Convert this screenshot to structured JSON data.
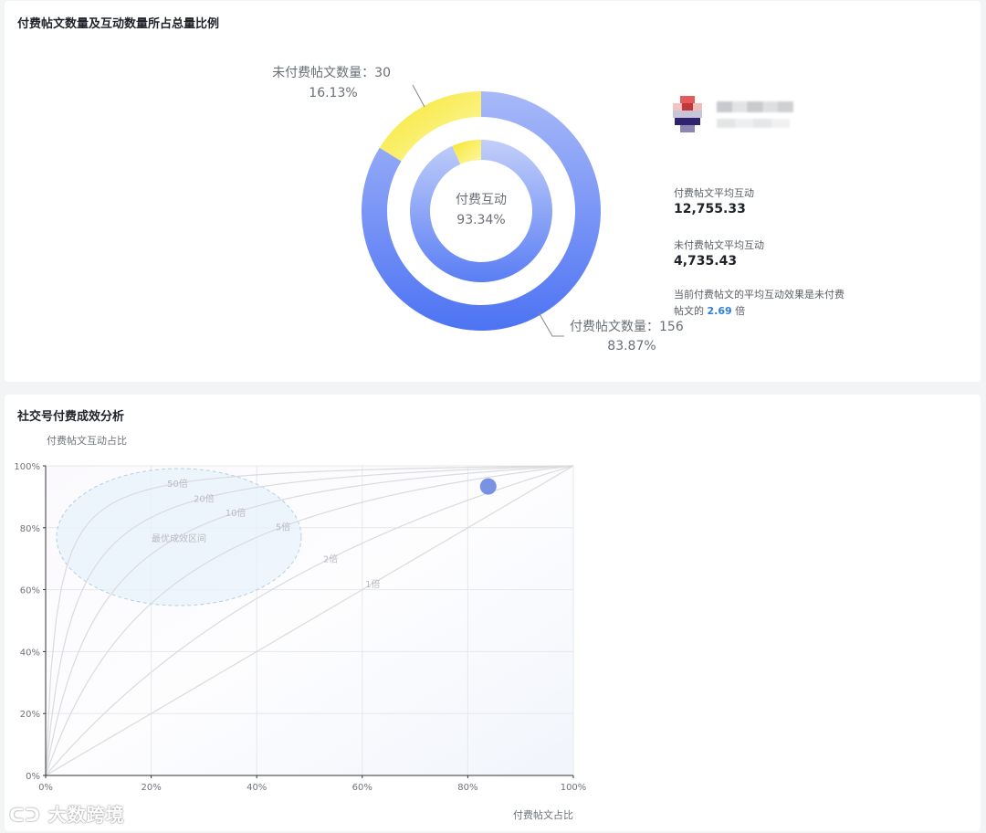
{
  "section1": {
    "title": "付费帖文数量及互动数量所占总量比例",
    "center_label": "付费互动",
    "center_value": "93.34%",
    "unpaid_label": "未付费帖文数量：30",
    "unpaid_pct": "16.13%",
    "paid_label": "付费帖文数量：156",
    "paid_pct": "83.87%",
    "colors": {
      "paid": "#5b7ff5",
      "unpaid": "#fbe84a",
      "inner_paid": "#7d9bf7"
    }
  },
  "chart_data": {
    "type": "scatter",
    "title": "社交号付费成效分析",
    "xlabel": "付费帖文占比",
    "ylabel": "付费帖文互动占比",
    "xlim": [
      0,
      100
    ],
    "ylim": [
      0,
      100
    ],
    "x_ticks": [
      "0%",
      "20%",
      "40%",
      "60%",
      "80%",
      "100%"
    ],
    "y_ticks": [
      "0%",
      "20%",
      "40%",
      "60%",
      "80%",
      "100%"
    ],
    "reference_curves": [
      {
        "label": "1倍",
        "multiple": 1
      },
      {
        "label": "2倍",
        "multiple": 2
      },
      {
        "label": "5倍",
        "multiple": 5
      },
      {
        "label": "10倍",
        "multiple": 10
      },
      {
        "label": "20倍",
        "multiple": 20
      },
      {
        "label": "50倍",
        "multiple": 50
      }
    ],
    "optimal_zone_label": "最优成效区间",
    "points": [
      {
        "x": 83.87,
        "y": 93.34
      }
    ],
    "grid": true,
    "point_color": "#6a86e0"
  },
  "stats": {
    "paid_avg_label": "付费帖文平均互动",
    "paid_avg_value": "12,755.33",
    "unpaid_avg_label": "未付费帖文平均互动",
    "unpaid_avg_value": "4,735.43",
    "summary_prefix": "当前付费帖文的平均互动效果是未付费帖文的",
    "summary_ratio": "2.69",
    "summary_suffix": "倍"
  },
  "watermark": "大数跨境"
}
